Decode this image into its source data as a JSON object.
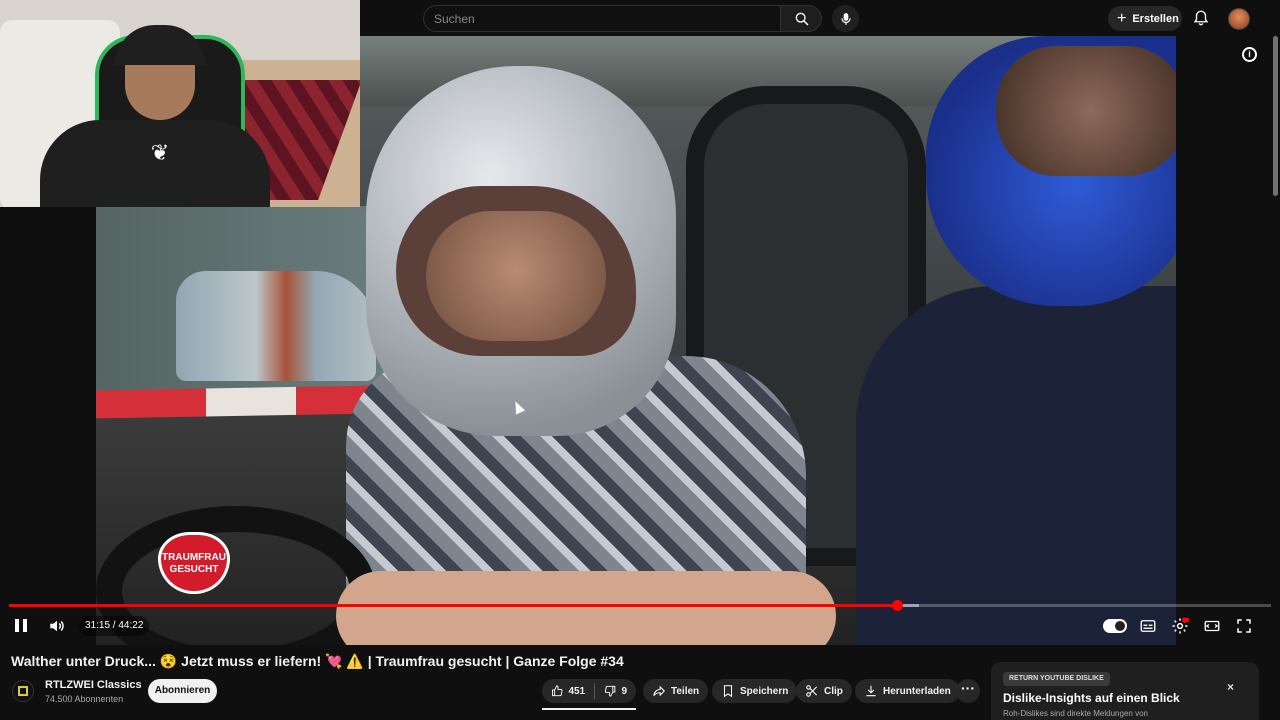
{
  "masthead": {
    "search_placeholder": "Suchen",
    "create_label": "Erstellen"
  },
  "overlay": {
    "show_logo_line1": "TRAUMFRAU",
    "show_logo_line2": "GESUCHT"
  },
  "player": {
    "time_display": "31:15 / 44:22",
    "progress_fraction": 0.7043,
    "buffered_fraction": 0.721,
    "colors": {
      "played": "#ff0000",
      "accent": "#ff0000"
    }
  },
  "video": {
    "title": "Walther unter Druck... 😵 Jetzt muss er liefern! 💘 ⚠️ | Traumfrau gesucht | Ganze Folge #34"
  },
  "channel": {
    "name": "RTLZWEI Classics",
    "subscribers": "74.500 Abonnenten",
    "subscribe_label": "Abonnieren"
  },
  "actions": {
    "likes": "451",
    "dislikes": "9",
    "share_label": "Teilen",
    "save_label": "Speichern",
    "clip_label": "Clip",
    "download_label": "Herunterladen",
    "more_label": "···"
  },
  "ryd_panel": {
    "tag": "RETURN YOUTUBE DISLIKE",
    "heading": "Dislike-Insights auf einen Blick",
    "subtext": "Roh-Dislikes sind direkte Meldungen von",
    "close_label": "×"
  }
}
